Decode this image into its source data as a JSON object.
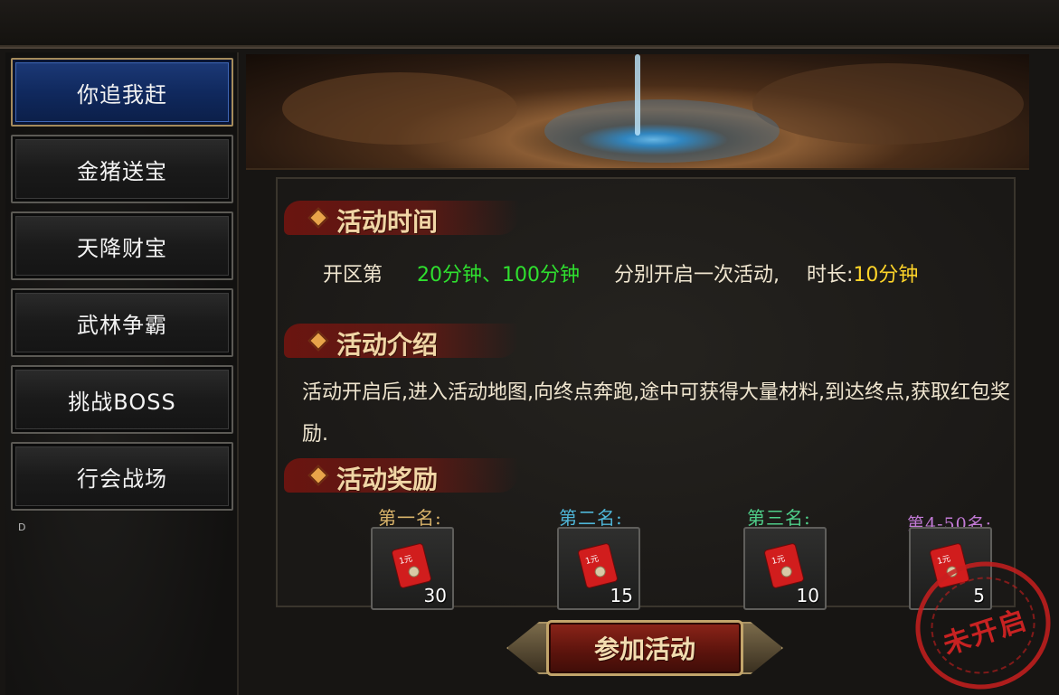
{
  "sidebar": {
    "items": [
      {
        "label": "你追我赶",
        "active": true
      },
      {
        "label": "金猪送宝",
        "active": false
      },
      {
        "label": "天降财宝",
        "active": false
      },
      {
        "label": "武林争霸",
        "active": false
      },
      {
        "label": "挑战BOSS",
        "active": false
      },
      {
        "label": "行会战场",
        "active": false
      }
    ],
    "mark": "D"
  },
  "sections": {
    "time": {
      "title": "活动时间",
      "prefix": "开区第",
      "minutes": "20分钟、100分钟",
      "middle": "分别开启一次活动,",
      "duration_label": "时长:",
      "duration_value": "10分钟"
    },
    "intro": {
      "title": "活动介绍",
      "text": "活动开启后,进入活动地图,向终点奔跑,途中可获得大量材料,到达终点,获取红包奖励."
    },
    "rewards": {
      "title": "活动奖励",
      "ranks": [
        {
          "label": "第一名:",
          "quantity": "30",
          "item_icon": "red-envelope-icon",
          "item_text": "1元",
          "color": "#d9b36a"
        },
        {
          "label": "第二名:",
          "quantity": "15",
          "item_icon": "red-envelope-icon",
          "item_text": "1元",
          "color": "#4fb6d8"
        },
        {
          "label": "第三名:",
          "quantity": "10",
          "item_icon": "red-envelope-icon",
          "item_text": "1元",
          "color": "#4fcf8a"
        },
        {
          "label": "第4-50名:",
          "quantity": "5",
          "item_icon": "red-envelope-icon",
          "item_text": "1元",
          "color": "#c27ad6"
        }
      ]
    }
  },
  "join_button": {
    "label": "参加活动"
  },
  "stamp": {
    "text": "未开启"
  },
  "colors": {
    "highlight_green": "#2fe02f",
    "highlight_yellow": "#ffd429",
    "active_tab": "#10295e",
    "title_banner": "#78140f"
  }
}
